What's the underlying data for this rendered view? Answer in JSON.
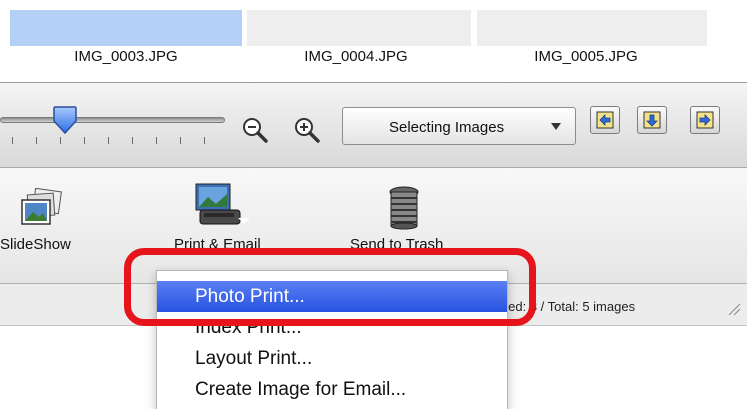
{
  "thumbnails": [
    {
      "label": "IMG_0003.JPG",
      "selected": true
    },
    {
      "label": "IMG_0004.JPG",
      "selected": false
    },
    {
      "label": "IMG_0005.JPG",
      "selected": false
    }
  ],
  "zoom": {
    "slider_level": 0.29,
    "zoom_out_icon": "zoom-out-icon",
    "zoom_in_icon": "zoom-in-icon"
  },
  "mode_select": {
    "value": "Selecting Images"
  },
  "nav_buttons": [
    "arrow-left-icon",
    "arrow-down-icon",
    "arrow-right-icon"
  ],
  "actions": {
    "slideshow": {
      "label": "SlideShow",
      "icon": "slideshow-icon"
    },
    "print_email": {
      "label": "Print & Email",
      "icon": "print-email-icon"
    },
    "trash": {
      "label": "Send to Trash",
      "icon": "trash-icon"
    }
  },
  "status": {
    "text": "Selected: 3 / Total: 5 images"
  },
  "menu": {
    "items": [
      {
        "label": "Photo Print...",
        "highlighted": true
      },
      {
        "label": "Index Print...",
        "highlighted": false
      },
      {
        "label": "Layout Print...",
        "highlighted": false
      },
      {
        "label": "Create Image for Email...",
        "highlighted": false
      }
    ]
  },
  "colors": {
    "selection": "#b4d0f7",
    "menu_highlight": "#2f5be6",
    "callout": "#e6141b"
  }
}
